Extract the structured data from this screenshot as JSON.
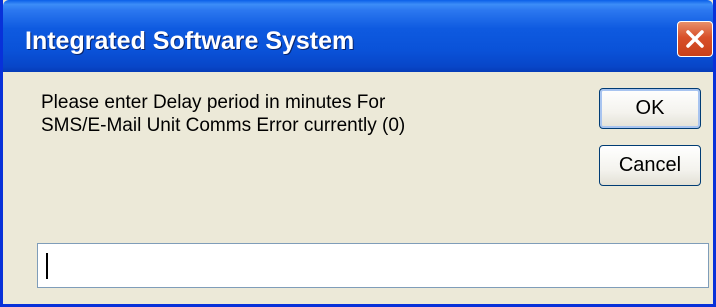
{
  "window": {
    "title": "Integrated Software System"
  },
  "message": {
    "line1": "Please enter Delay period in minutes For",
    "line2": "SMS/E-Mail Unit Comms Error currently (0)"
  },
  "buttons": {
    "ok_label": "OK",
    "cancel_label": "Cancel"
  },
  "input": {
    "value": ""
  },
  "icons": {
    "close": "close-icon"
  },
  "colors": {
    "titlebar": "#0A52D8",
    "dialog_background": "#ECE9D8",
    "close_button": "#D8502A"
  }
}
